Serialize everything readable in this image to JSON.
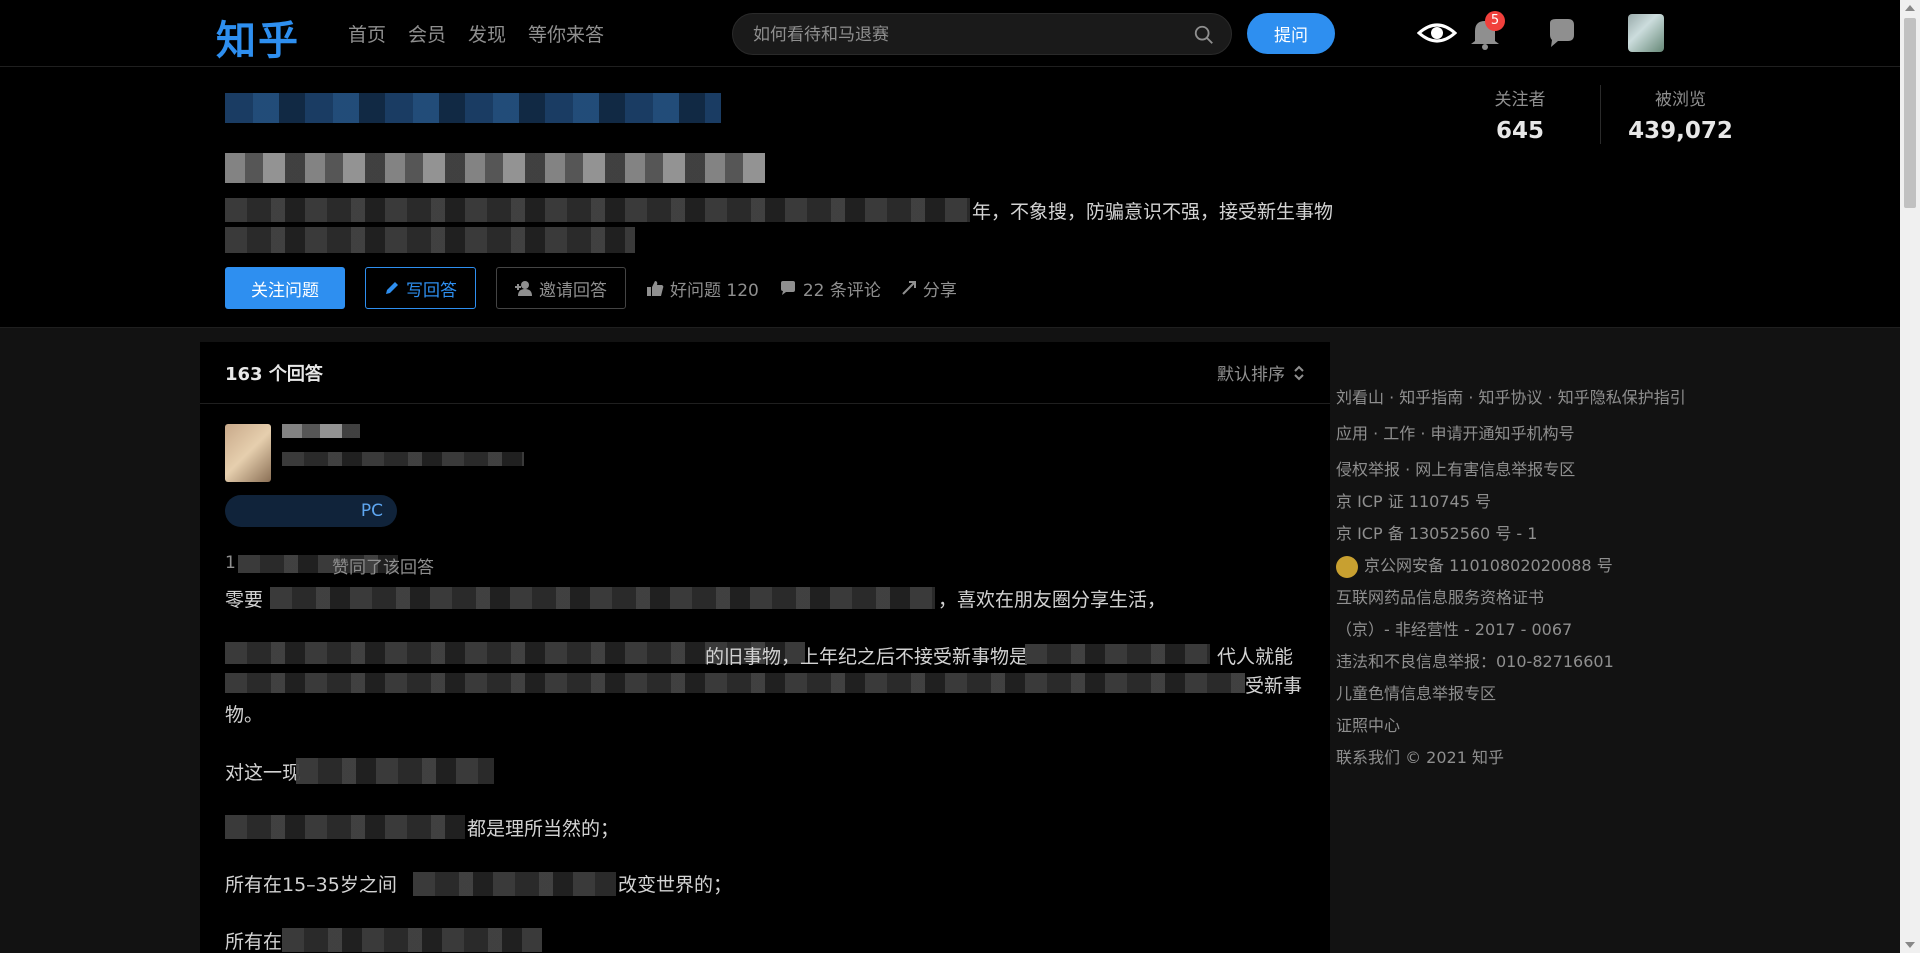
{
  "nav": {
    "logo": "知乎",
    "links": [
      "首页",
      "会员",
      "发现",
      "等你来答"
    ],
    "search_placeholder": "如何看待和马退赛",
    "ask_label": "提问",
    "notification_count": "5"
  },
  "question": {
    "desc_tail": "年，不象搜，防骗意识不强，接受新生事物",
    "actions": {
      "follow": "关注问题",
      "write": "写回答",
      "invite": "邀请回答",
      "good": "好问题 120",
      "comments": "22 条评论",
      "share": "分享"
    },
    "stats": [
      {
        "label": "关注者",
        "value": "645"
      },
      {
        "label": "被浏览",
        "value": "439,072"
      }
    ]
  },
  "answers": {
    "count": "163 个回答",
    "sort": "默认排序",
    "tag_suffix": "PC",
    "upvote_line": "1",
    "upvote_tail": "赞同了该回答",
    "paragraphs": {
      "p1_head": "零要",
      "p1_tail": "，喜欢在朋友圈分享生活，",
      "p2_head": "",
      "p2_mid": "的旧事物，上年纪之后不接受新事物是",
      "p2_tail": "代人就能",
      "p3_tail": "受新事",
      "p4": "物。",
      "p5": "对这一现",
      "p6_tail": "都是理所当然的；",
      "p7": "所有在15–35岁之间",
      "p7_tail": "改变世界的；",
      "p8": "所有在"
    }
  },
  "footer": {
    "lines": [
      "刘看山 · 知乎指南 · 知乎协议 · 知乎隐私保护指引",
      "应用 · 工作 · 申请开通知乎机构号",
      "侵权举报 · 网上有害信息举报专区",
      "京 ICP 证 110745 号",
      "京 ICP 备 13052560 号 - 1"
    ],
    "police": "京公网安备 11010802020088 号",
    "lines2": [
      "互联网药品信息服务资格证书",
      "（京）- 非经营性 - 2017 - 0067",
      "违法和不良信息举报：010-82716601",
      "儿童色情信息举报专区",
      "证照中心",
      "联系我们 © 2021 知乎"
    ]
  },
  "colors": {
    "accent": "#2e8ff0",
    "background": "#000000",
    "badge": "#f1403c"
  }
}
